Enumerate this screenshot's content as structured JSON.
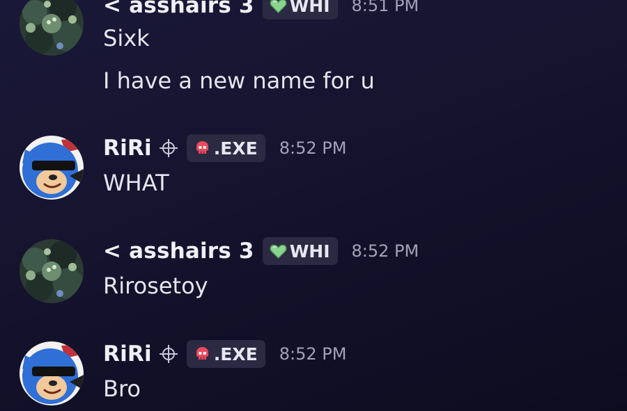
{
  "colors": {
    "background": "#15132d",
    "username": "#f0eff7",
    "timestamp": "#a3a2b8",
    "badge_bg": "#2b2a42",
    "heart_badge": "#8ad48f",
    "skull_badge": "#e84a5f"
  },
  "messages": [
    {
      "author": "< asshairs 3",
      "badge_icon": "green-heart-icon",
      "badge": "WHI",
      "time": "8:51 PM",
      "lines": [
        "Sixk",
        "I have a new name for u"
      ]
    },
    {
      "author": "RiRi",
      "author_icon": "crosshair-icon",
      "badge_icon": "red-skull-icon",
      "badge": ".EXE",
      "time": "8:52 PM",
      "lines": [
        "WHAT"
      ]
    },
    {
      "author": "< asshairs 3",
      "badge_icon": "green-heart-icon",
      "badge": "WHI",
      "time": "8:52 PM",
      "lines": [
        "Rirosetoy"
      ]
    },
    {
      "author": "RiRi",
      "author_icon": "crosshair-icon",
      "badge_icon": "red-skull-icon",
      "badge": ".EXE",
      "time": "8:52 PM",
      "lines": [
        "Bro"
      ]
    }
  ]
}
